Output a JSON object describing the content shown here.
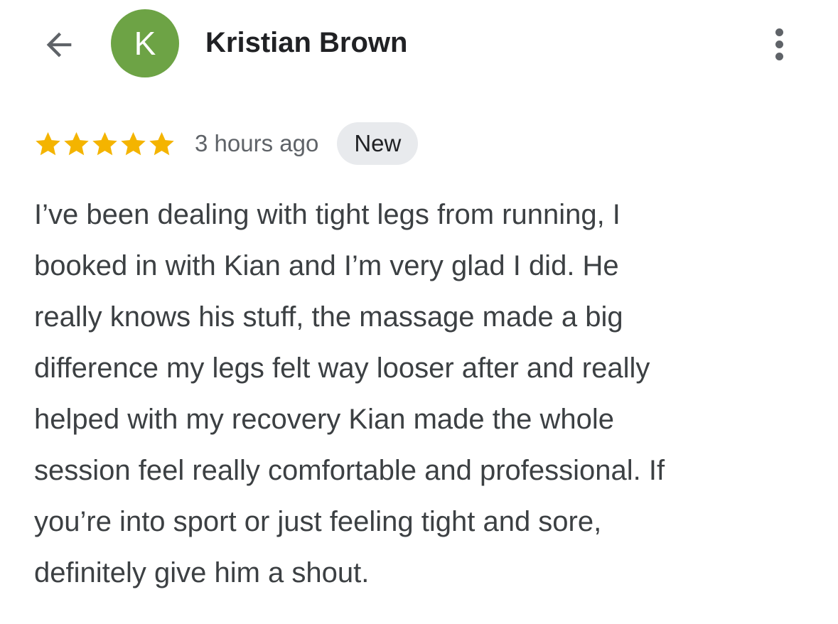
{
  "header": {
    "back_icon": "arrow-back-icon",
    "avatar_initial": "K",
    "avatar_color": "#6da345",
    "author_name": "Kristian Brown",
    "more_icon": "more-vert-icon"
  },
  "review": {
    "rating": 5,
    "rating_max": 5,
    "star_color": "#f4b400",
    "time_ago": "3 hours ago",
    "badge": "New",
    "text": "I’ve been dealing with tight legs from running, I\nbooked in with Kian and I’m very glad I did. He\nreally knows his stuff, the massage made a big\ndifference my legs felt way looser after and really\nhelped with my recovery Kian made the whole\nsession feel really comfortable and professional. If\nyou’re into sport or just feeling tight and sore,\ndefinitely give him a shout."
  }
}
